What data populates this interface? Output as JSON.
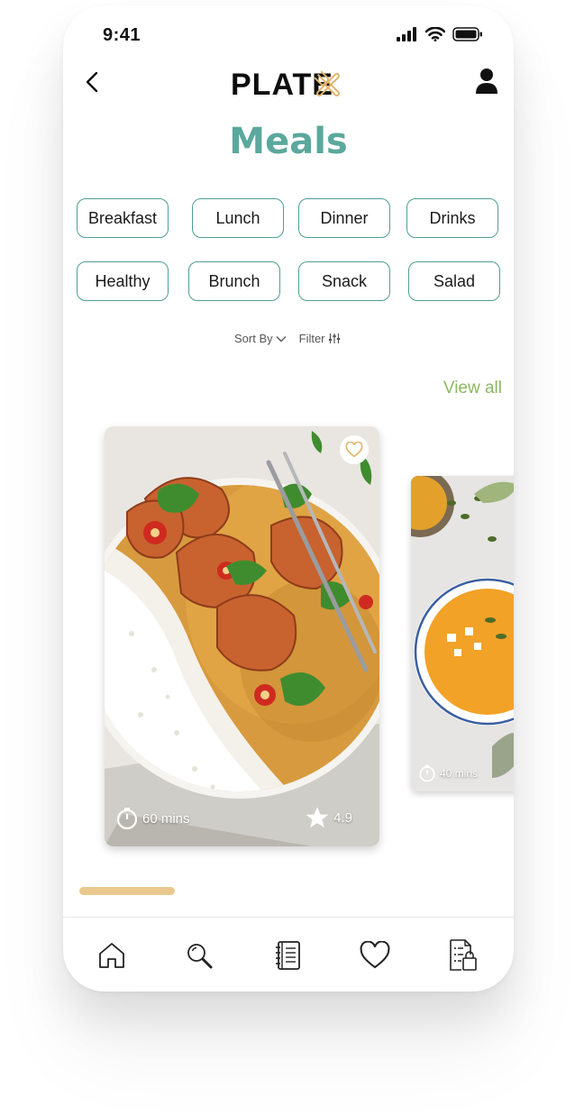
{
  "status": {
    "time": "9:41"
  },
  "header": {
    "brand": "PLATEX",
    "back_icon": "chevron-left-icon",
    "profile_icon": "user-icon"
  },
  "page": {
    "title": "Meals"
  },
  "categories": [
    "Breakfast",
    "Lunch",
    "Dinner",
    "Drinks",
    "Healthy",
    "Brunch",
    "Snack",
    "Salad"
  ],
  "controls": {
    "sort_label": "Sort By",
    "filter_label": "Filter"
  },
  "section": {
    "view_all": "View all"
  },
  "cards": [
    {
      "time": "60 mins",
      "rating": "4.9",
      "favorite": false
    },
    {
      "time": "40 mins"
    }
  ],
  "nav": {
    "items": [
      {
        "icon": "home-icon"
      },
      {
        "icon": "search-icon"
      },
      {
        "icon": "recipe-book-icon"
      },
      {
        "icon": "heart-icon"
      },
      {
        "icon": "shopping-list-icon"
      }
    ]
  },
  "colors": {
    "accent": "#5ba89c",
    "chip_border": "#4f9e95",
    "view_all": "#8db863",
    "indicator": "#e9c98e",
    "heart": "#e2b46a"
  }
}
